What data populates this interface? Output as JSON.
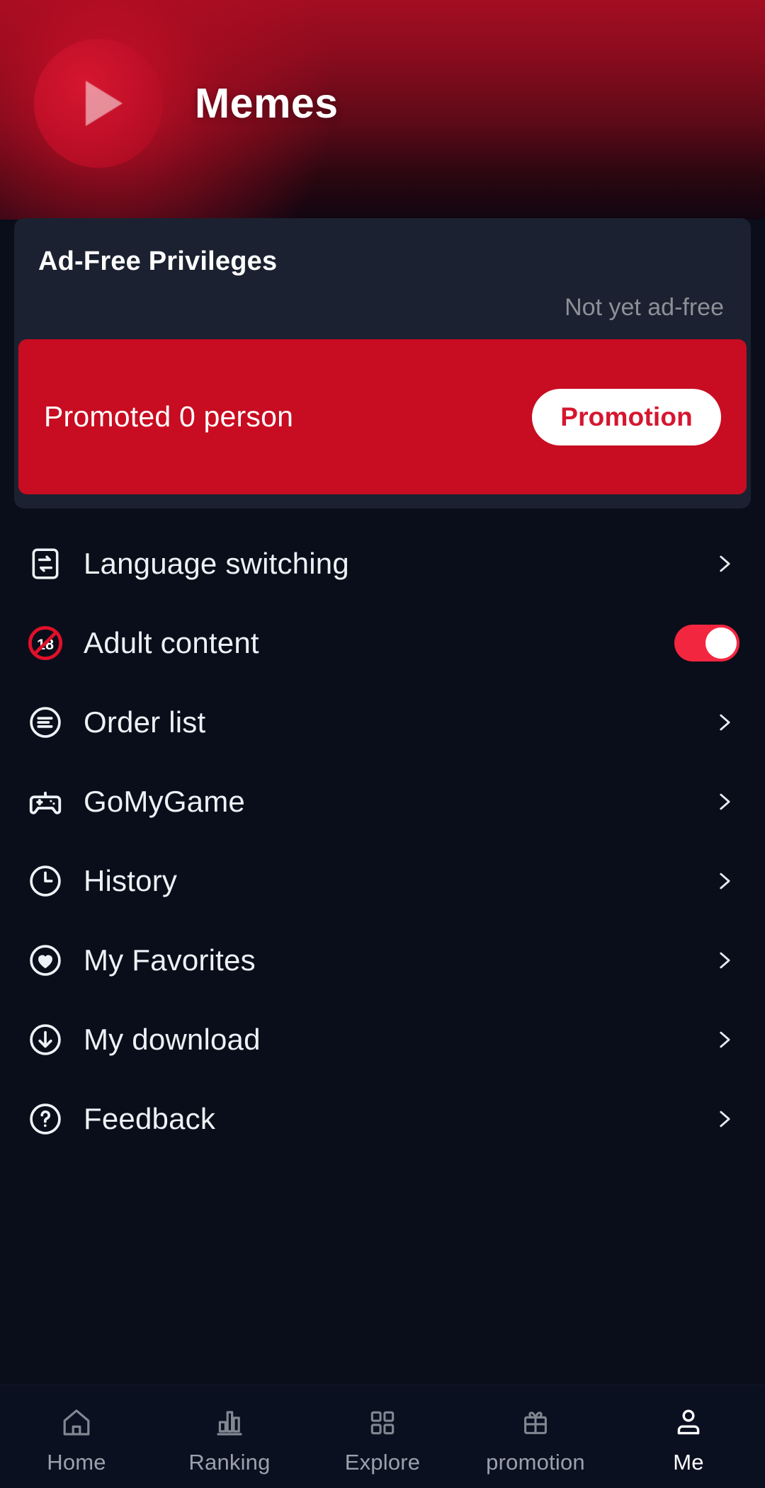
{
  "header": {
    "title": "Memes",
    "avatar_icon": "play-triangle-icon"
  },
  "adfree": {
    "title": "Ad-Free Privileges",
    "status": "Not yet ad-free",
    "promo_text": "Promoted 0 person",
    "promo_button": "Promotion"
  },
  "menu": {
    "items": [
      {
        "label": "Language switching",
        "icon": "language-switch-icon",
        "control": "chevron"
      },
      {
        "label": "Adult content",
        "icon": "age-18-restricted-icon",
        "control": "toggle",
        "toggle_on": true
      },
      {
        "label": "Order list",
        "icon": "order-list-icon",
        "control": "chevron"
      },
      {
        "label": "GoMyGame",
        "icon": "gamepad-icon",
        "control": "chevron"
      },
      {
        "label": "History",
        "icon": "clock-icon",
        "control": "chevron"
      },
      {
        "label": "My Favorites",
        "icon": "heart-icon",
        "control": "chevron"
      },
      {
        "label": "My download",
        "icon": "download-arrow-icon",
        "control": "chevron"
      },
      {
        "label": "Feedback",
        "icon": "question-mark-icon",
        "control": "chevron"
      }
    ]
  },
  "bottom_nav": {
    "items": [
      {
        "label": "Home",
        "icon": "home-icon",
        "active": false
      },
      {
        "label": "Ranking",
        "icon": "bar-chart-icon",
        "active": false
      },
      {
        "label": "Explore",
        "icon": "grid-icon",
        "active": false
      },
      {
        "label": "promotion",
        "icon": "gift-icon",
        "active": false
      },
      {
        "label": "Me",
        "icon": "person-icon",
        "active": true
      }
    ]
  },
  "colors": {
    "brand_red": "#c80c21",
    "toggle_red": "#f3263f",
    "background": "#0a0e1a",
    "card": "#1b2130",
    "nav_bar": "#0b1020",
    "muted_text": "#8d9098"
  }
}
